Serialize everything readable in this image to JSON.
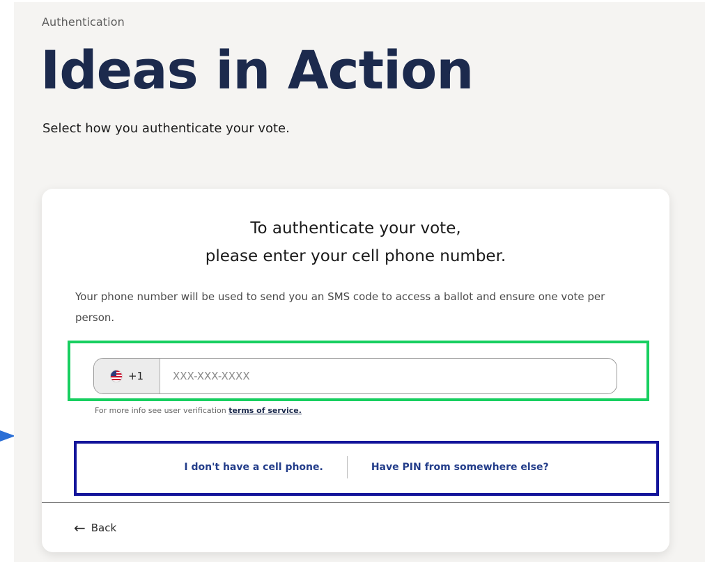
{
  "header": {
    "eyebrow": "Authentication",
    "title": "Ideas in Action",
    "subtitle": "Select how you authenticate your vote."
  },
  "card": {
    "heading_line1": "To authenticate your vote,",
    "heading_line2": "please enter your cell phone number.",
    "description": "Your phone number will be used to send you an SMS code to access a ballot and ensure one vote per person.",
    "phone": {
      "country_code": "+1",
      "country_flag_icon": "us-flag-icon",
      "value": "",
      "placeholder": "XXX-XXX-XXXX"
    },
    "tos_prefix": "For more info see user verification",
    "tos_link": "terms of service."
  },
  "alternatives": {
    "no_phone": "I don't have a cell phone.",
    "have_pin": "Have PIN from somewhere else?"
  },
  "footer": {
    "back_icon": "←",
    "back_label": "Back"
  },
  "colors": {
    "title": "#1c2a4d",
    "link": "#233d8a",
    "highlight_green": "#18cf60",
    "highlight_blue": "#13149a",
    "pointer": "#2b6fd6"
  }
}
